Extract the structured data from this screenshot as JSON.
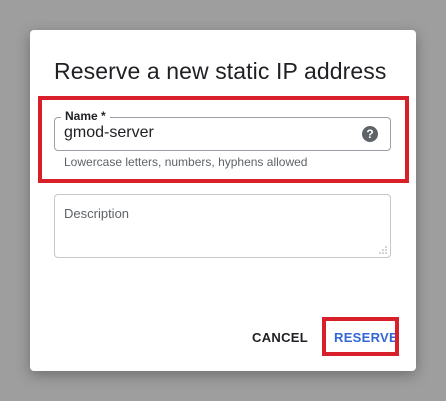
{
  "dialog": {
    "title": "Reserve a new static IP address",
    "name_field": {
      "label": "Name *",
      "value": "gmod-server",
      "hint": "Lowercase letters, numbers, hyphens allowed",
      "help_icon": "help-icon"
    },
    "description_field": {
      "placeholder": "Description",
      "value": ""
    },
    "buttons": {
      "cancel_label": "CANCEL",
      "reserve_label": "RESERVE"
    },
    "colors": {
      "accent": "#3367d6",
      "highlight": "#d8202a",
      "backdrop": "#9e9e9e"
    }
  }
}
